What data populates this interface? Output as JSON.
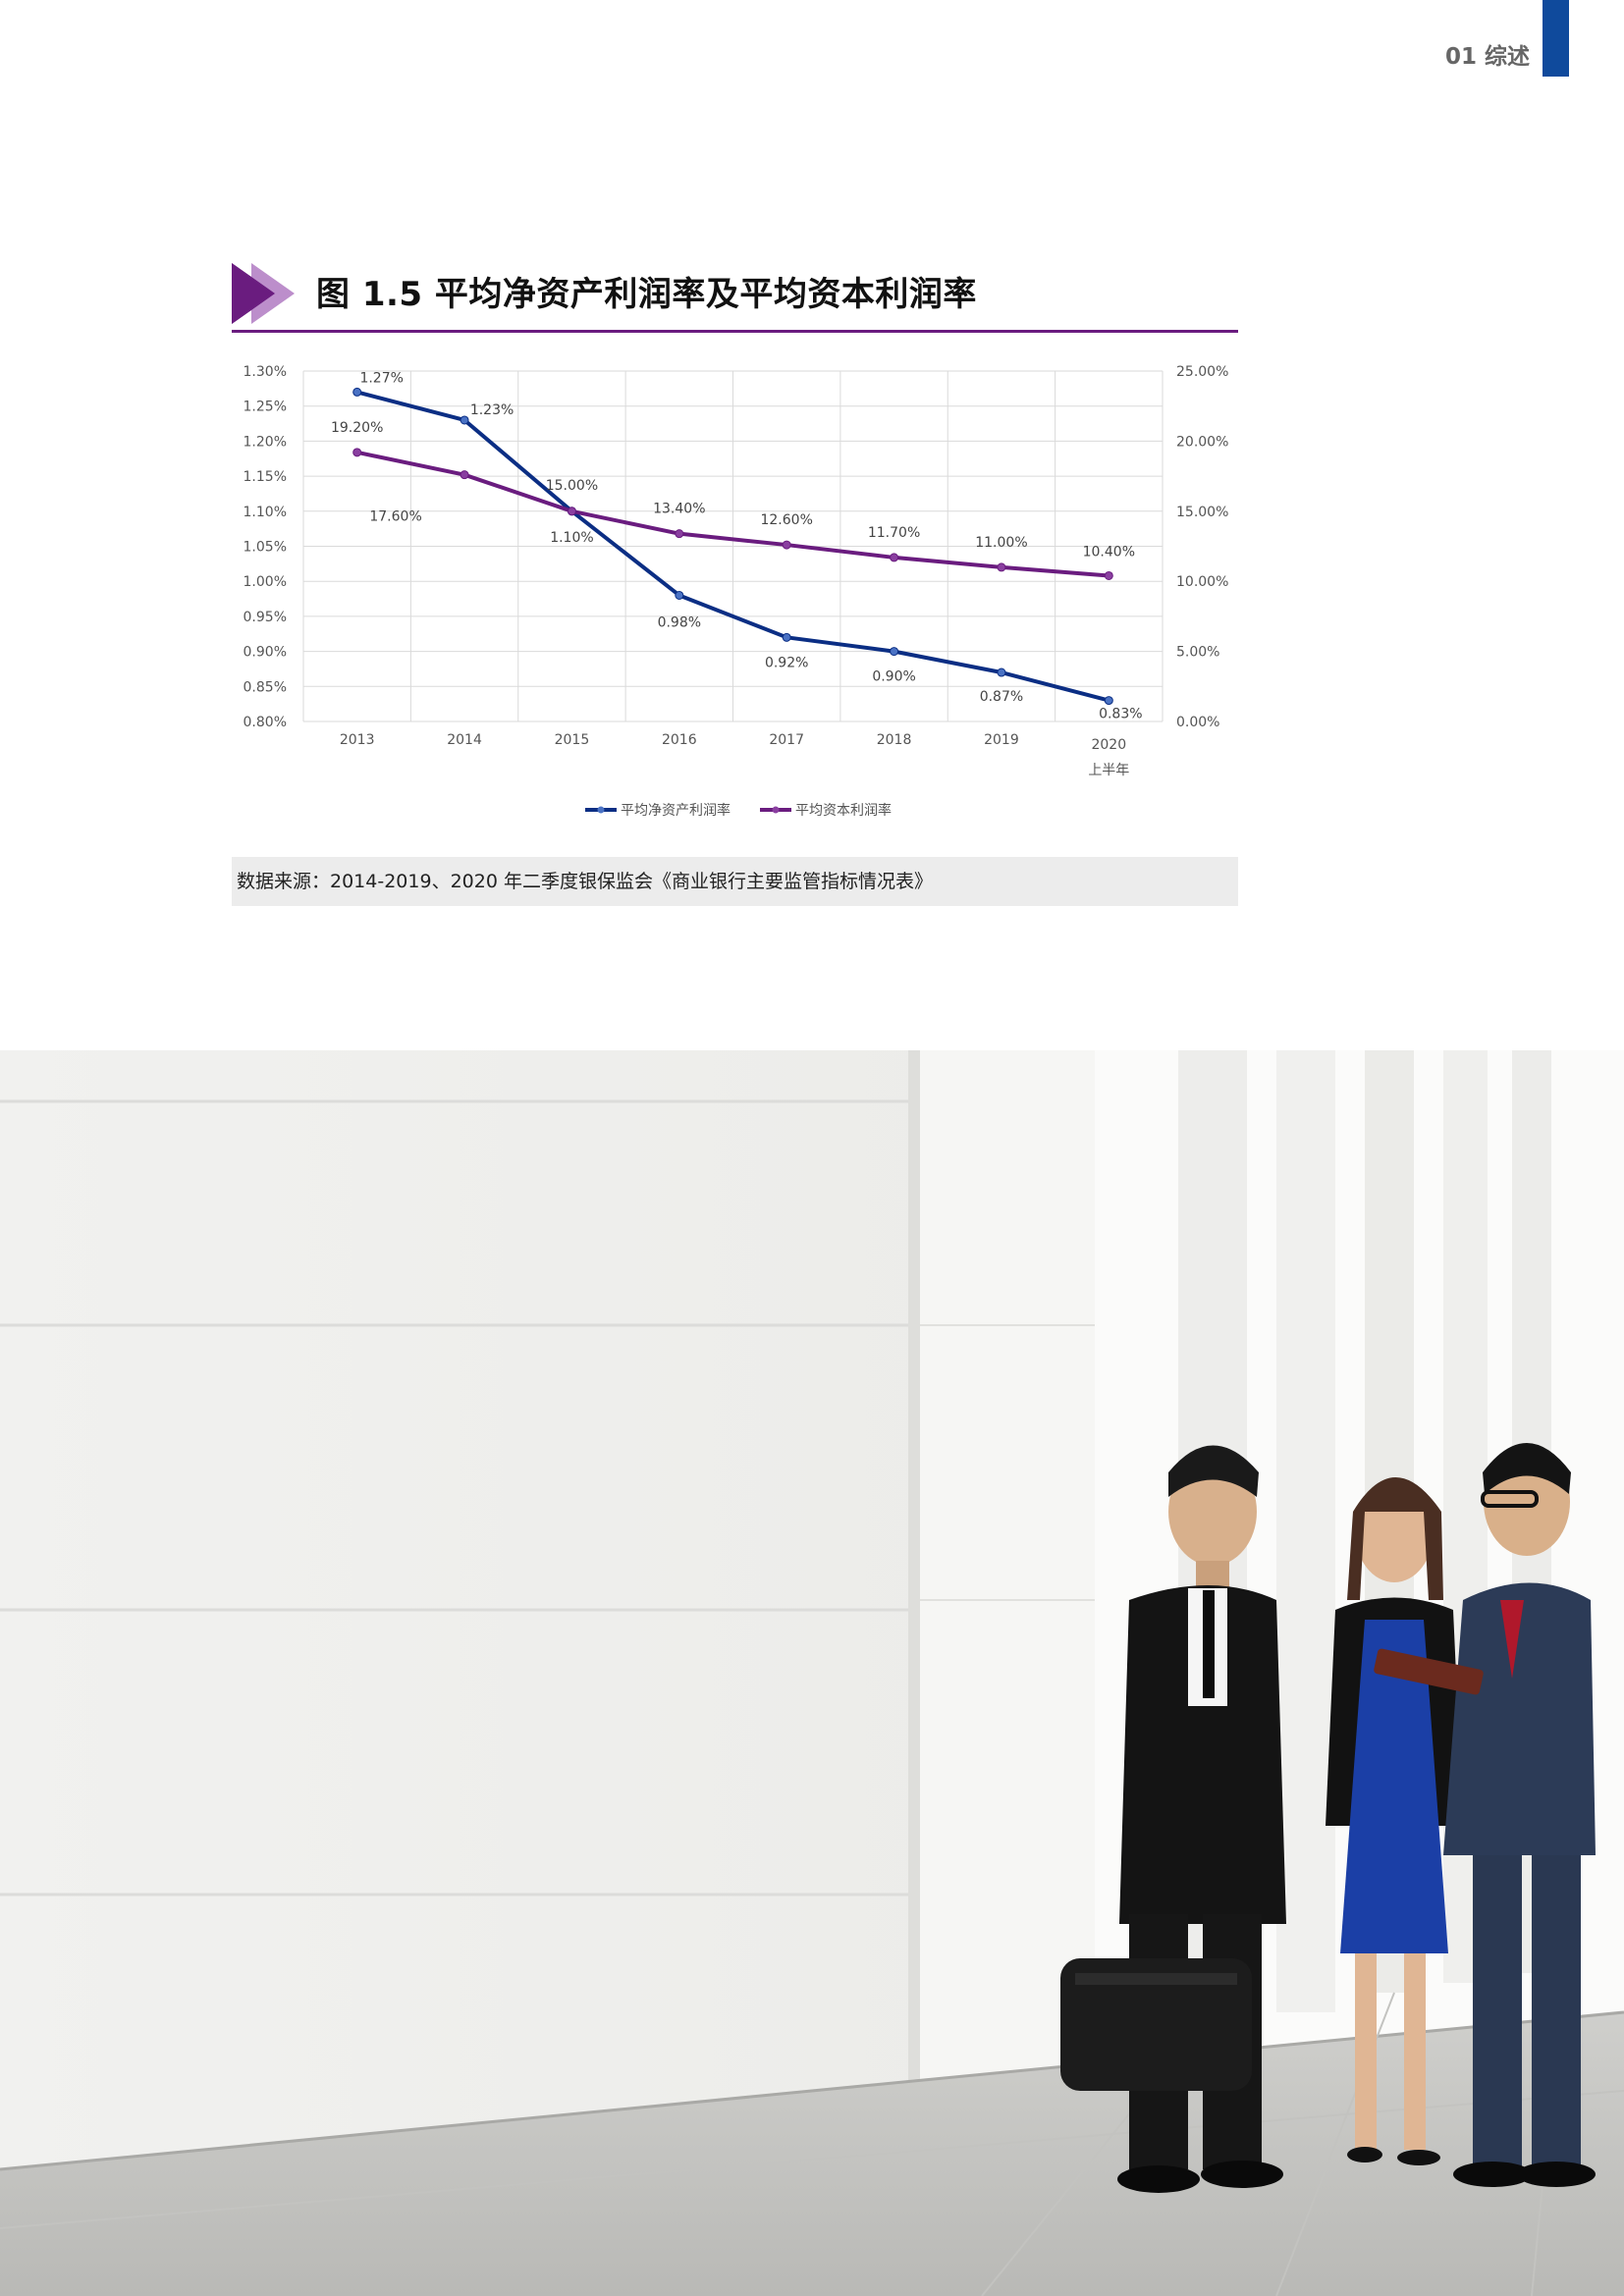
{
  "header": {
    "section_label": "01 综述",
    "bar_color": "#0f4a9c"
  },
  "figure": {
    "title": "图 1.5 平均净资产利润率及平均资本利润率",
    "accent_color": "#6a1c7f",
    "source": "数据来源：2014-2019、2020 年二季度银保监会《商业银行主要监管指标情况表》"
  },
  "chart_data": {
    "type": "line",
    "categories": [
      "2013",
      "2014",
      "2015",
      "2016",
      "2017",
      "2018",
      "2019",
      "2020 上半年"
    ],
    "category_lines": [
      [
        "2013"
      ],
      [
        "2014"
      ],
      [
        "2015"
      ],
      [
        "2016"
      ],
      [
        "2017"
      ],
      [
        "2018"
      ],
      [
        "2019"
      ],
      [
        "2020",
        "上半年"
      ]
    ],
    "series": [
      {
        "name": "平均净资产利润率",
        "axis": "left",
        "color": "#0b2e84",
        "values": [
          1.27,
          1.23,
          1.1,
          0.98,
          0.92,
          0.9,
          0.87,
          0.83
        ],
        "labels": [
          "1.27%",
          "1.23%",
          "1.10%",
          "0.98%",
          "0.92%",
          "0.90%",
          "0.87%",
          "0.83%"
        ]
      },
      {
        "name": "平均资本利润率",
        "axis": "right",
        "color": "#6a1c7f",
        "values": [
          19.2,
          17.6,
          15.0,
          13.4,
          12.6,
          11.7,
          11.0,
          10.4
        ],
        "labels": [
          "19.20%",
          "17.60%",
          "15.00%",
          "13.40%",
          "12.60%",
          "11.70%",
          "11.00%",
          "10.40%"
        ]
      }
    ],
    "y_left": {
      "range": [
        0.8,
        1.3
      ],
      "ticks": [
        "1.30%",
        "1.25%",
        "1.20%",
        "1.15%",
        "1.10%",
        "1.05%",
        "1.00%",
        "0.95%",
        "0.90%",
        "0.85%",
        "0.80%"
      ]
    },
    "y_right": {
      "range": [
        0,
        25
      ],
      "ticks": [
        "25.00%",
        "20.00%",
        "15.00%",
        "10.00%",
        "5.00%",
        "0.00%"
      ]
    },
    "grid": true,
    "legend_position": "bottom"
  }
}
